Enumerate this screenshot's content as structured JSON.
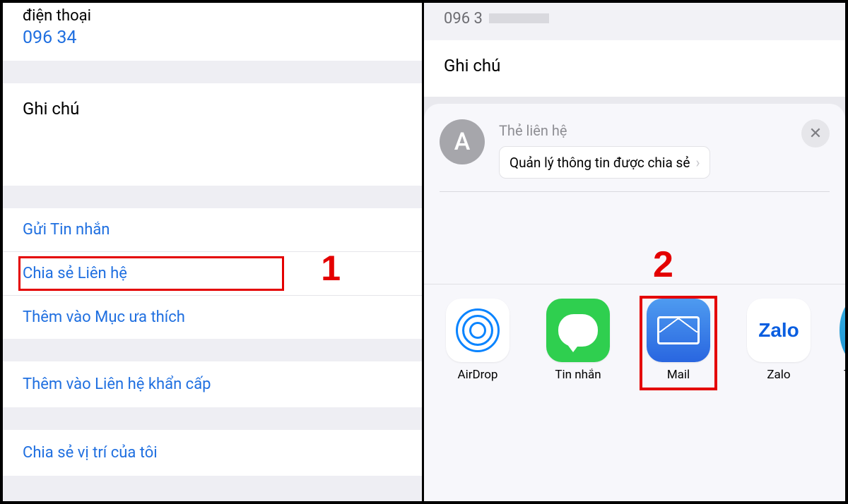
{
  "left": {
    "phone_label": "điện thoại",
    "phone_number": "096 34",
    "notes_label": "Ghi chú",
    "actions": {
      "send_message": "Gửi Tin nhắn",
      "share_contact": "Chia sẻ Liên hệ",
      "add_favorite": "Thêm vào Mục ưa thích",
      "add_emergency": "Thêm vào Liên hệ khẩn cấp",
      "share_location": "Chia sẻ vị trí của tôi"
    },
    "annotation_1": "1"
  },
  "right": {
    "phone_partial": "096 3",
    "notes_label": "Ghi chú",
    "sheet": {
      "avatar_letter": "A",
      "title": "Thẻ liên hệ",
      "manage_label": "Quản lý thông tin được chia sẻ"
    },
    "apps": {
      "airdrop": "AirDrop",
      "messages": "Tin nhắn",
      "mail": "Mail",
      "zalo": "Zalo",
      "telegram_partial": "Te",
      "zalo_text": "Zalo"
    },
    "annotation_2": "2"
  }
}
